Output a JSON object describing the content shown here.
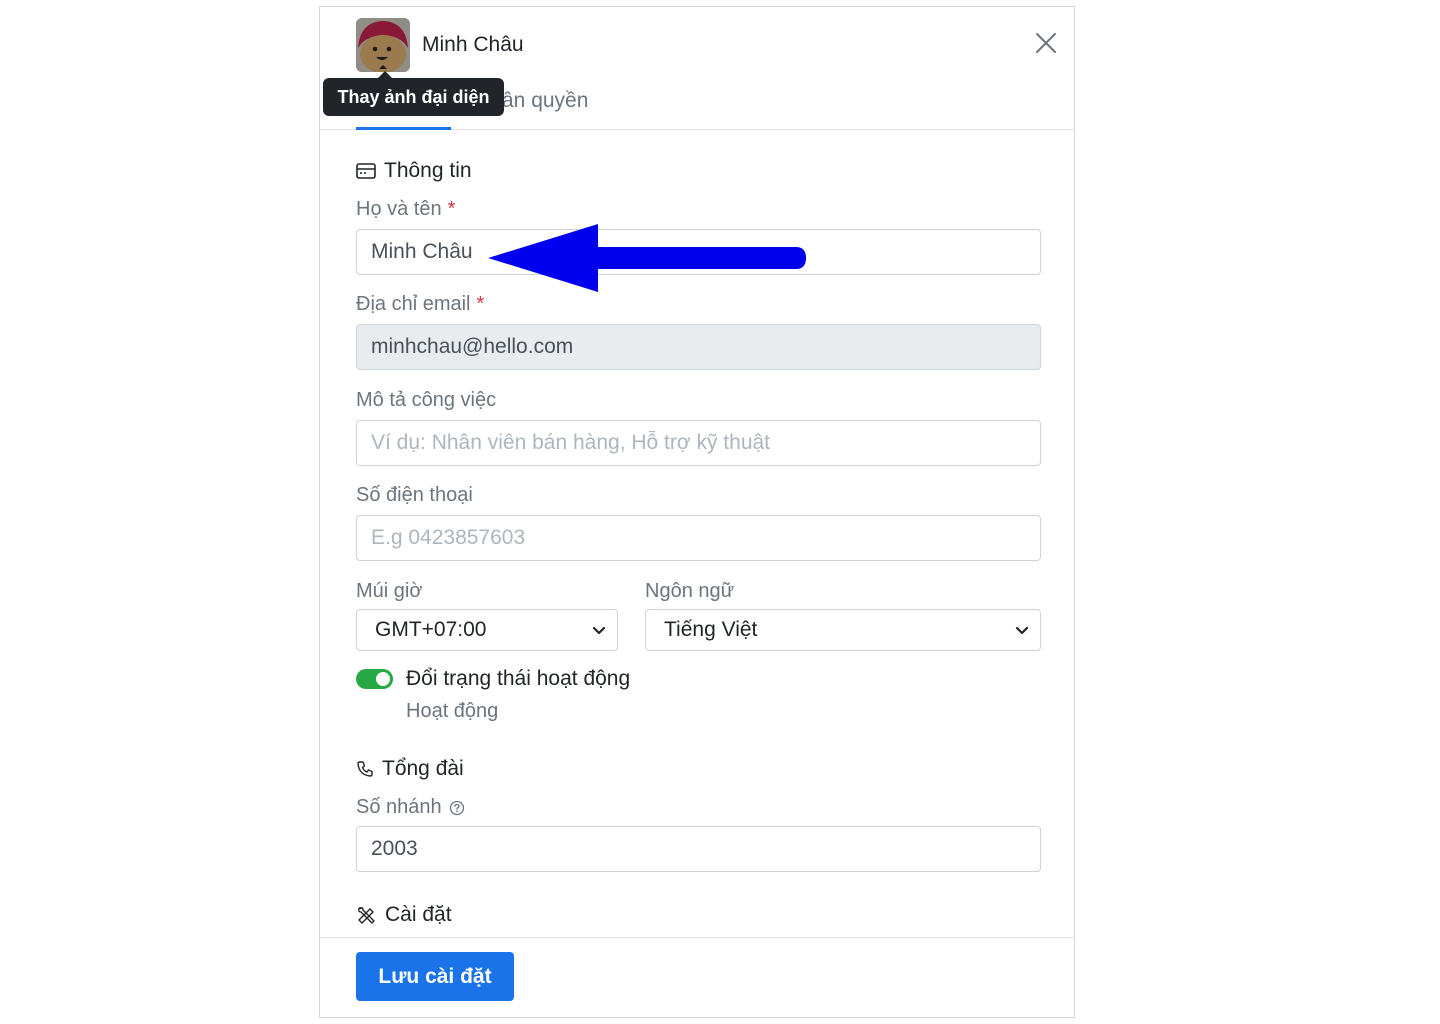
{
  "header": {
    "name": "Minh Châu",
    "avatar_tooltip": "Thay ảnh đại diện",
    "tab_partial": "ân quyền"
  },
  "info_section": {
    "title": "Thông tin",
    "full_name": {
      "label": "Họ và tên",
      "required_mark": "*",
      "value": "Minh Châu"
    },
    "email": {
      "label": "Địa chỉ email",
      "required_mark": "*",
      "value": "minhchau@hello.com"
    },
    "job": {
      "label": "Mô tả công việc",
      "placeholder": "Ví dụ: Nhân viên bán hàng, Hỗ trợ kỹ thuật",
      "value": ""
    },
    "phone": {
      "label": "Số điện thoại",
      "placeholder": "E.g 0423857603",
      "value": ""
    },
    "timezone": {
      "label": "Múi giờ",
      "value": "GMT+07:00"
    },
    "language": {
      "label": "Ngôn ngữ",
      "value": "Tiếng Việt"
    },
    "status_toggle": {
      "label": "Đổi trạng thái hoạt động",
      "status": "Hoạt động",
      "on": true
    }
  },
  "switchboard_section": {
    "title": "Tổng đài",
    "extension": {
      "label": "Số nhánh",
      "value": "2003"
    }
  },
  "settings_section": {
    "title": "Cài đặt"
  },
  "footer": {
    "save_label": "Lưu cài đặt"
  },
  "colors": {
    "primary": "#1a73e8",
    "toggle_on": "#28a745",
    "arrow": "#0000ee"
  },
  "icons": {
    "close": "close-icon",
    "info": "id-card-icon",
    "phone": "phone-icon",
    "help": "question-circle-icon",
    "settings": "tools-icon",
    "chevron": "chevron-down-icon"
  }
}
